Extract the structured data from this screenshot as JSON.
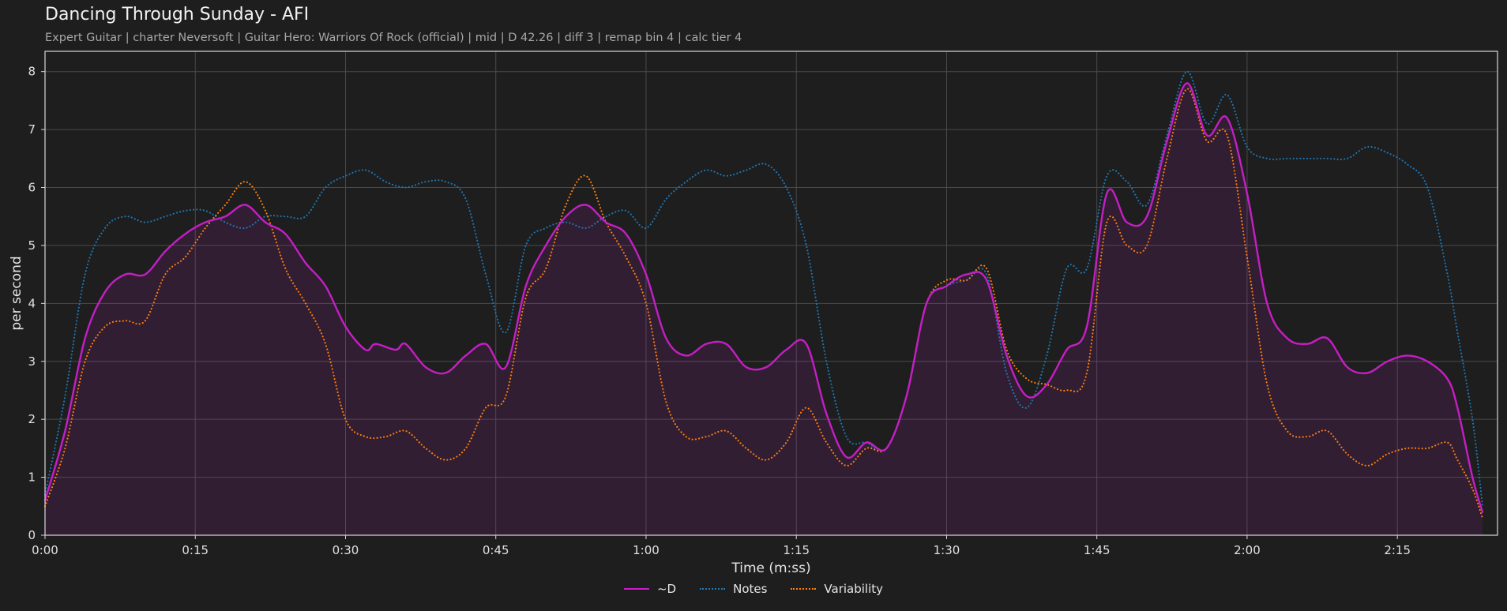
{
  "title": "Dancing Through Sunday - AFI",
  "subtitle": "Expert Guitar  |  charter Neversoft  |  Guitar Hero: Warriors Of Rock (official)  |  mid  |  D 42.26  |  diff 3  |  remap bin 4  |  calc tier 4",
  "chart_data": {
    "type": "line",
    "xlabel": "Time (m:ss)",
    "ylabel": "per second",
    "xlim": [
      0,
      145
    ],
    "ylim": [
      0,
      8.35
    ],
    "x_ticks": [
      0,
      15,
      30,
      45,
      60,
      75,
      90,
      105,
      120,
      135
    ],
    "x_tick_labels": [
      "0:00",
      "0:15",
      "0:30",
      "0:45",
      "1:00",
      "1:15",
      "1:30",
      "1:45",
      "2:00",
      "2:15"
    ],
    "y_ticks": [
      0,
      1,
      2,
      3,
      4,
      5,
      6,
      7,
      8
    ],
    "y_tick_labels": [
      "0",
      "1",
      "2",
      "3",
      "4",
      "5",
      "6",
      "7",
      "8"
    ],
    "grid": true,
    "legend_position": "bottom-center",
    "series": [
      {
        "name": "~D",
        "color": "#c41fc4",
        "style": "solid",
        "fill": true,
        "points": [
          [
            0,
            0.6
          ],
          [
            2,
            1.8
          ],
          [
            4,
            3.4
          ],
          [
            6,
            4.2
          ],
          [
            8,
            4.5
          ],
          [
            10,
            4.5
          ],
          [
            12,
            4.9
          ],
          [
            14,
            5.2
          ],
          [
            16,
            5.4
          ],
          [
            18,
            5.5
          ],
          [
            20,
            5.7
          ],
          [
            22,
            5.4
          ],
          [
            24,
            5.2
          ],
          [
            26,
            4.7
          ],
          [
            28,
            4.3
          ],
          [
            30,
            3.6
          ],
          [
            32,
            3.2
          ],
          [
            33,
            3.3
          ],
          [
            35,
            3.2
          ],
          [
            36,
            3.3
          ],
          [
            38,
            2.9
          ],
          [
            40,
            2.8
          ],
          [
            42,
            3.1
          ],
          [
            44,
            3.3
          ],
          [
            46,
            2.9
          ],
          [
            48,
            4.3
          ],
          [
            50,
            5.0
          ],
          [
            52,
            5.5
          ],
          [
            54,
            5.7
          ],
          [
            56,
            5.4
          ],
          [
            58,
            5.2
          ],
          [
            60,
            4.5
          ],
          [
            62,
            3.4
          ],
          [
            64,
            3.1
          ],
          [
            66,
            3.3
          ],
          [
            68,
            3.3
          ],
          [
            70,
            2.9
          ],
          [
            72,
            2.9
          ],
          [
            74,
            3.2
          ],
          [
            76,
            3.3
          ],
          [
            78,
            2.1
          ],
          [
            80,
            1.35
          ],
          [
            82,
            1.6
          ],
          [
            84,
            1.5
          ],
          [
            86,
            2.4
          ],
          [
            88,
            4.0
          ],
          [
            90,
            4.3
          ],
          [
            92,
            4.5
          ],
          [
            94,
            4.4
          ],
          [
            96,
            3.1
          ],
          [
            98,
            2.4
          ],
          [
            100,
            2.6
          ],
          [
            102,
            3.2
          ],
          [
            104,
            3.6
          ],
          [
            106,
            5.9
          ],
          [
            108,
            5.4
          ],
          [
            110,
            5.5
          ],
          [
            112,
            6.8
          ],
          [
            114,
            7.8
          ],
          [
            116,
            6.9
          ],
          [
            118,
            7.2
          ],
          [
            120,
            5.9
          ],
          [
            122,
            4.0
          ],
          [
            124,
            3.4
          ],
          [
            126,
            3.3
          ],
          [
            128,
            3.4
          ],
          [
            130,
            2.9
          ],
          [
            132,
            2.8
          ],
          [
            134,
            3.0
          ],
          [
            136,
            3.1
          ],
          [
            138,
            3.0
          ],
          [
            140,
            2.7
          ],
          [
            141,
            2.2
          ],
          [
            142.5,
            1.0
          ],
          [
            143.5,
            0.4
          ]
        ]
      },
      {
        "name": "Notes",
        "color": "#1f77b4",
        "style": "dotted",
        "fill": false,
        "points": [
          [
            0,
            0.7
          ],
          [
            2,
            2.4
          ],
          [
            4,
            4.5
          ],
          [
            6,
            5.3
          ],
          [
            8,
            5.5
          ],
          [
            10,
            5.4
          ],
          [
            12,
            5.5
          ],
          [
            14,
            5.6
          ],
          [
            16,
            5.6
          ],
          [
            18,
            5.4
          ],
          [
            20,
            5.3
          ],
          [
            22,
            5.5
          ],
          [
            24,
            5.5
          ],
          [
            26,
            5.5
          ],
          [
            28,
            6.0
          ],
          [
            30,
            6.2
          ],
          [
            32,
            6.3
          ],
          [
            34,
            6.1
          ],
          [
            36,
            6.0
          ],
          [
            38,
            6.1
          ],
          [
            40,
            6.1
          ],
          [
            42,
            5.8
          ],
          [
            44,
            4.5
          ],
          [
            46,
            3.5
          ],
          [
            48,
            5.0
          ],
          [
            50,
            5.3
          ],
          [
            52,
            5.4
          ],
          [
            54,
            5.3
          ],
          [
            56,
            5.5
          ],
          [
            58,
            5.6
          ],
          [
            60,
            5.3
          ],
          [
            62,
            5.8
          ],
          [
            64,
            6.1
          ],
          [
            66,
            6.3
          ],
          [
            68,
            6.2
          ],
          [
            70,
            6.3
          ],
          [
            72,
            6.4
          ],
          [
            74,
            6.0
          ],
          [
            76,
            5.0
          ],
          [
            78,
            3.0
          ],
          [
            80,
            1.7
          ],
          [
            82,
            1.6
          ],
          [
            84,
            1.5
          ],
          [
            86,
            2.4
          ],
          [
            88,
            4.0
          ],
          [
            90,
            4.3
          ],
          [
            92,
            4.4
          ],
          [
            94,
            4.5
          ],
          [
            96,
            2.8
          ],
          [
            98,
            2.2
          ],
          [
            100,
            3.1
          ],
          [
            102,
            4.6
          ],
          [
            104,
            4.6
          ],
          [
            106,
            6.2
          ],
          [
            108,
            6.1
          ],
          [
            110,
            5.7
          ],
          [
            112,
            6.9
          ],
          [
            114,
            8.0
          ],
          [
            116,
            7.1
          ],
          [
            118,
            7.6
          ],
          [
            120,
            6.7
          ],
          [
            122,
            6.5
          ],
          [
            124,
            6.5
          ],
          [
            126,
            6.5
          ],
          [
            128,
            6.5
          ],
          [
            130,
            6.5
          ],
          [
            132,
            6.7
          ],
          [
            134,
            6.6
          ],
          [
            136,
            6.4
          ],
          [
            138,
            6.0
          ],
          [
            140,
            4.5
          ],
          [
            141,
            3.5
          ],
          [
            142.5,
            2.0
          ],
          [
            143.5,
            0.5
          ]
        ]
      },
      {
        "name": "Variability",
        "color": "#ff7f0e",
        "style": "dotted",
        "fill": false,
        "points": [
          [
            0,
            0.5
          ],
          [
            2,
            1.5
          ],
          [
            4,
            3.0
          ],
          [
            6,
            3.6
          ],
          [
            8,
            3.7
          ],
          [
            10,
            3.7
          ],
          [
            12,
            4.5
          ],
          [
            14,
            4.8
          ],
          [
            16,
            5.3
          ],
          [
            18,
            5.7
          ],
          [
            20,
            6.1
          ],
          [
            22,
            5.6
          ],
          [
            24,
            4.6
          ],
          [
            26,
            4.0
          ],
          [
            28,
            3.3
          ],
          [
            30,
            2.0
          ],
          [
            32,
            1.7
          ],
          [
            34,
            1.7
          ],
          [
            36,
            1.8
          ],
          [
            38,
            1.5
          ],
          [
            40,
            1.3
          ],
          [
            42,
            1.5
          ],
          [
            44,
            2.2
          ],
          [
            46,
            2.4
          ],
          [
            48,
            4.1
          ],
          [
            50,
            4.6
          ],
          [
            52,
            5.7
          ],
          [
            54,
            6.2
          ],
          [
            56,
            5.4
          ],
          [
            58,
            4.8
          ],
          [
            60,
            4.0
          ],
          [
            62,
            2.3
          ],
          [
            64,
            1.7
          ],
          [
            66,
            1.7
          ],
          [
            68,
            1.8
          ],
          [
            70,
            1.5
          ],
          [
            72,
            1.3
          ],
          [
            74,
            1.6
          ],
          [
            76,
            2.2
          ],
          [
            78,
            1.6
          ],
          [
            80,
            1.2
          ],
          [
            82,
            1.5
          ],
          [
            84,
            1.5
          ],
          [
            86,
            2.4
          ],
          [
            88,
            4.0
          ],
          [
            90,
            4.4
          ],
          [
            92,
            4.4
          ],
          [
            94,
            4.6
          ],
          [
            96,
            3.2
          ],
          [
            98,
            2.7
          ],
          [
            100,
            2.6
          ],
          [
            102,
            2.5
          ],
          [
            104,
            2.8
          ],
          [
            106,
            5.4
          ],
          [
            108,
            5.0
          ],
          [
            110,
            5.0
          ],
          [
            112,
            6.5
          ],
          [
            114,
            7.7
          ],
          [
            116,
            6.8
          ],
          [
            118,
            6.9
          ],
          [
            120,
            4.8
          ],
          [
            122,
            2.6
          ],
          [
            124,
            1.8
          ],
          [
            126,
            1.7
          ],
          [
            128,
            1.8
          ],
          [
            130,
            1.4
          ],
          [
            132,
            1.2
          ],
          [
            134,
            1.4
          ],
          [
            136,
            1.5
          ],
          [
            138,
            1.5
          ],
          [
            140,
            1.6
          ],
          [
            141,
            1.3
          ],
          [
            142.5,
            0.8
          ],
          [
            143.5,
            0.3
          ]
        ]
      }
    ]
  }
}
